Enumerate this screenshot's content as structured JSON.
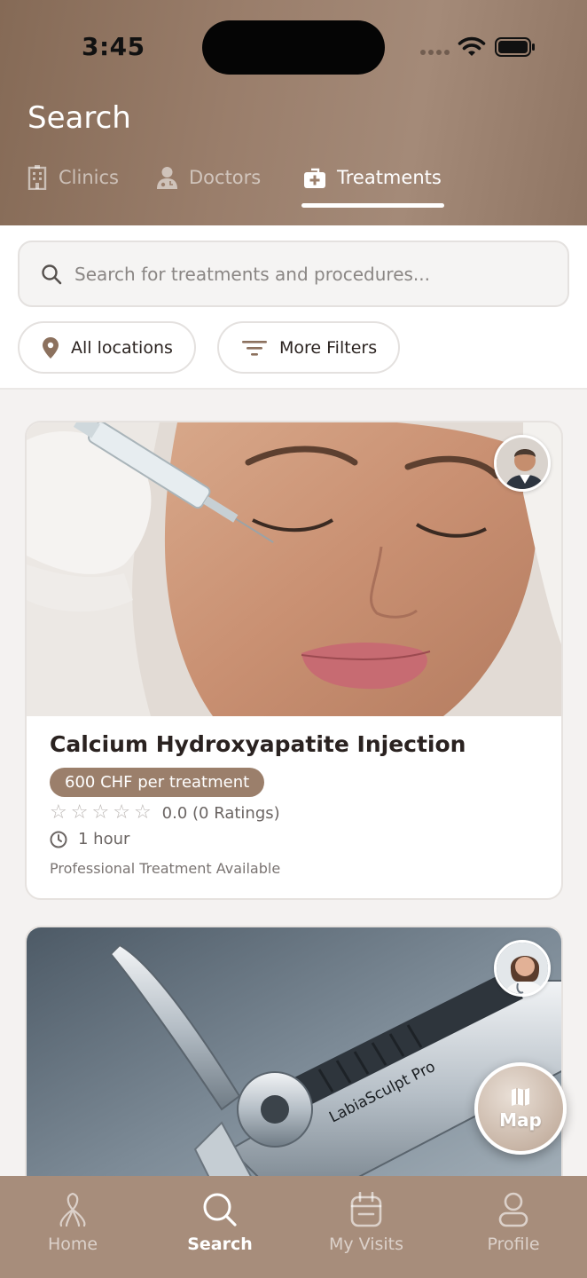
{
  "status_bar": {
    "time": "3:45"
  },
  "header": {
    "title": "Search",
    "tabs": [
      {
        "label": "Clinics",
        "icon": "building-icon",
        "active": false
      },
      {
        "label": "Doctors",
        "icon": "doctor-icon",
        "active": false
      },
      {
        "label": "Treatments",
        "icon": "medkit-icon",
        "active": true
      }
    ]
  },
  "search": {
    "placeholder": "Search for treatments and procedures...",
    "filters": [
      {
        "label": "All locations",
        "icon": "location-pin-icon"
      },
      {
        "label": "More Filters",
        "icon": "filter-lines-icon"
      }
    ]
  },
  "cards": [
    {
      "title": "Calcium Hydroxyapatite Injection",
      "price": "600 CHF per treatment",
      "rating": "0.0 (0 Ratings)",
      "stars": 0,
      "duration": "1 hour",
      "availability": "Professional Treatment Available"
    },
    {
      "image_text": "LabiaSculpt Pro"
    }
  ],
  "map_button": {
    "label": "Map"
  },
  "bottom_nav": [
    {
      "label": "Home",
      "icon": "home-icon",
      "active": false
    },
    {
      "label": "Search",
      "icon": "search-icon",
      "active": true
    },
    {
      "label": "My Visits",
      "icon": "calendar-icon",
      "active": false
    },
    {
      "label": "Profile",
      "icon": "profile-icon",
      "active": false
    }
  ],
  "colors": {
    "header_gradient_start": "#856a56",
    "accent": "#9b7f6b",
    "bottom_nav": "#a78d7b"
  }
}
